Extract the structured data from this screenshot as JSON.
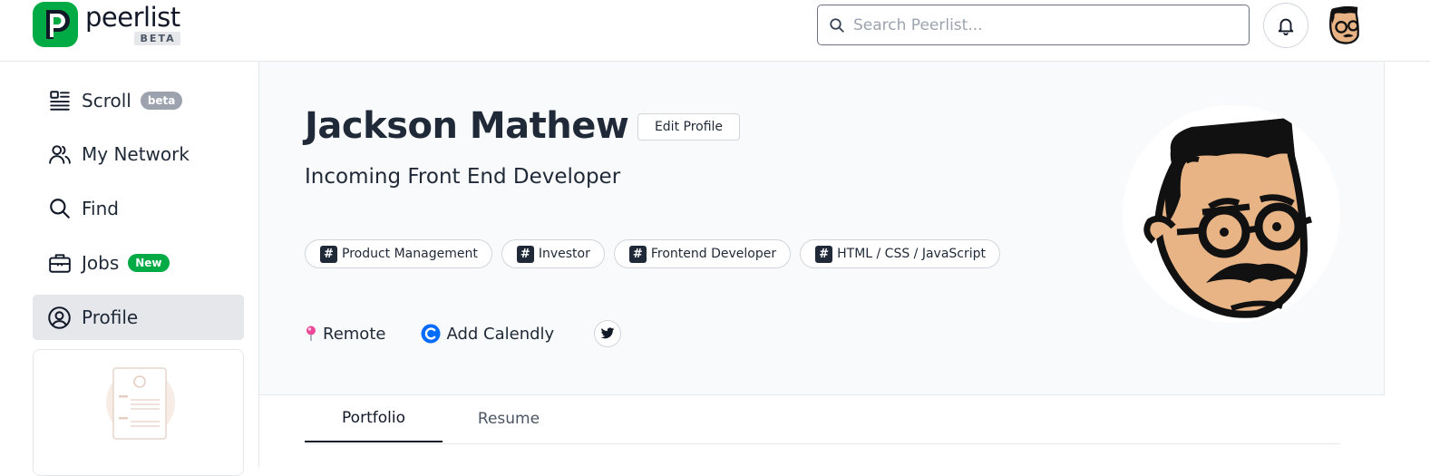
{
  "header": {
    "brand_name": "peerlist",
    "brand_badge": "BETA",
    "search_placeholder": "Search Peerlist...",
    "search_value": ""
  },
  "sidebar": {
    "items": [
      {
        "label": "Scroll",
        "icon": "feed-icon",
        "badge": "beta"
      },
      {
        "label": "My Network",
        "icon": "users-icon"
      },
      {
        "label": "Find",
        "icon": "search-icon"
      },
      {
        "label": "Jobs",
        "icon": "briefcase-icon",
        "badge": "New"
      },
      {
        "label": "Profile",
        "icon": "user-circle-icon",
        "active": true
      }
    ]
  },
  "profile": {
    "name": "Jackson Mathew",
    "edit_label": "Edit Profile",
    "headline": "Incoming Front End Developer",
    "tags": [
      "Product Management",
      "Investor",
      "Frontend Developer",
      "HTML / CSS / JavaScript"
    ],
    "location": "Remote",
    "calendly_label": "Add Calendly"
  },
  "tabs": [
    {
      "label": "Portfolio",
      "active": true
    },
    {
      "label": "Resume",
      "active": false
    }
  ],
  "colors": {
    "brand_green": "#00aa45",
    "badge_gray": "#9ca3af",
    "location_pink": "#ec4899",
    "calendly_blue": "#006bff",
    "avatar_skin": "#e8b486"
  }
}
